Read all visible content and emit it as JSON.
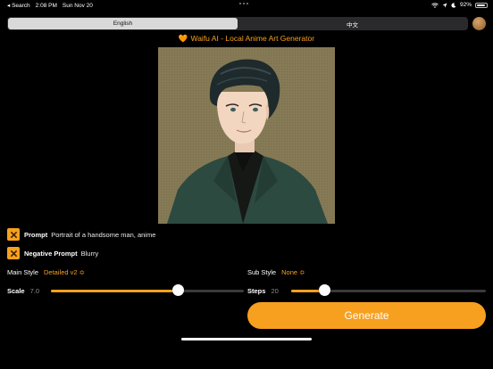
{
  "status": {
    "back": "◂ Search",
    "time": "2:08 PM",
    "date": "Sun Nov 20",
    "battery": "92%",
    "battery_level": 0.92
  },
  "segmented": {
    "options": [
      "English",
      "中文"
    ],
    "selected": "English"
  },
  "title": {
    "heart": "🧡",
    "text": "Waifu AI - Local Anime Art Generator"
  },
  "prompt": {
    "label": "Prompt",
    "value": "Portrait of a handsome man, anime"
  },
  "negative_prompt": {
    "label": "Negative Prompt",
    "value": "Blurry"
  },
  "main_style": {
    "label": "Main Style",
    "value": "Detailed v2 ≎"
  },
  "sub_style": {
    "label": "Sub Style",
    "value": "None ≎"
  },
  "scale": {
    "label": "Scale",
    "value": "7.0",
    "fraction": 0.66
  },
  "steps": {
    "label": "Steps",
    "value": "20",
    "fraction": 0.17
  },
  "generate_label": "Generate",
  "colors": {
    "accent": "#f7a01f",
    "background": "#000000"
  }
}
